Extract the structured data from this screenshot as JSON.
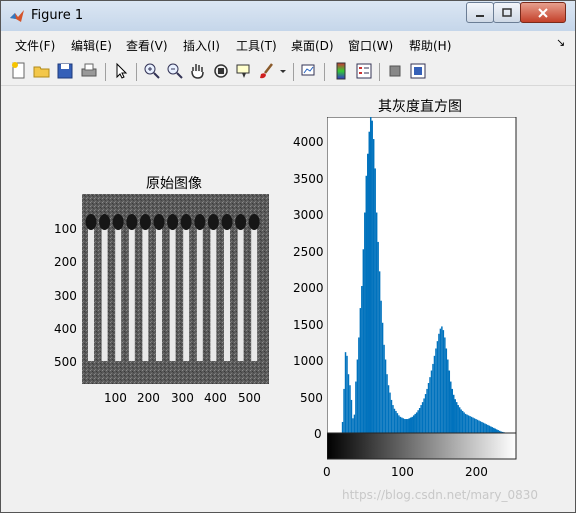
{
  "window": {
    "title": "Figure 1"
  },
  "menu": [
    "文件(F)",
    "编辑(E)",
    "查看(V)",
    "插入(I)",
    "工具(T)",
    "桌面(D)",
    "窗口(W)",
    "帮助(H)"
  ],
  "toolbar": {
    "icons": [
      "new-figure-icon",
      "open-file-icon",
      "save-icon",
      "print-icon",
      "pointer-icon",
      "zoom-in-icon",
      "zoom-out-icon",
      "pan-icon",
      "rotate-3d-icon",
      "data-cursor-icon",
      "brush-icon",
      "brush-dropdown-icon",
      "link-plot-icon",
      "colorbar-icon",
      "legend-icon",
      "hide-plot-tools-icon",
      "show-plot-tools-icon"
    ]
  },
  "left_axes": {
    "title": "原始图像",
    "y_ticks": [
      "100",
      "200",
      "300",
      "400",
      "500"
    ],
    "x_ticks": [
      "100",
      "200",
      "300",
      "400",
      "500"
    ]
  },
  "right_axes": {
    "title": "其灰度直方图",
    "y_ticks": [
      "4000",
      "3500",
      "3000",
      "2500",
      "2000",
      "1500",
      "1000",
      "500",
      "0"
    ],
    "x_ticks": [
      "0",
      "100",
      "200"
    ]
  },
  "watermark": "https://blog.csdn.net/mary_0830",
  "chart_data": {
    "type": "bar",
    "title": "其灰度直方图",
    "xlim": [
      0,
      255
    ],
    "ylim": [
      0,
      4300
    ],
    "x": [
      20,
      22,
      24,
      26,
      28,
      30,
      32,
      34,
      36,
      38,
      40,
      42,
      44,
      46,
      48,
      50,
      52,
      54,
      56,
      58,
      60,
      62,
      64,
      66,
      68,
      70,
      72,
      74,
      76,
      78,
      80,
      82,
      84,
      86,
      88,
      90,
      92,
      94,
      96,
      98,
      100,
      102,
      104,
      106,
      108,
      110,
      112,
      114,
      116,
      118,
      120,
      122,
      124,
      126,
      128,
      130,
      132,
      134,
      136,
      138,
      140,
      142,
      144,
      146,
      148,
      150,
      152,
      154,
      156,
      158,
      160,
      162,
      164,
      166,
      168,
      170,
      172,
      174,
      176,
      178,
      180,
      182,
      184,
      186,
      188,
      190,
      192,
      194,
      196,
      198,
      200,
      202,
      204,
      206,
      208,
      210,
      212,
      214,
      216,
      218,
      220,
      222,
      224,
      226,
      228,
      230,
      232,
      234,
      236,
      238,
      240,
      242,
      244,
      246,
      248,
      250,
      252,
      254
    ],
    "values": [
      150,
      600,
      1100,
      1050,
      800,
      650,
      450,
      200,
      250,
      700,
      1000,
      1300,
      1700,
      2000,
      2500,
      3000,
      3500,
      3800,
      4100,
      4300,
      4250,
      4000,
      3600,
      3000,
      2600,
      2200,
      1800,
      1500,
      1200,
      1000,
      800,
      650,
      550,
      450,
      380,
      330,
      300,
      270,
      240,
      220,
      210,
      200,
      190,
      190,
      190,
      200,
      210,
      220,
      240,
      260,
      280,
      310,
      340,
      380,
      420,
      470,
      530,
      600,
      680,
      760,
      850,
      940,
      1050,
      1150,
      1250,
      1350,
      1420,
      1450,
      1400,
      1300,
      1150,
      1000,
      850,
      700,
      600,
      520,
      460,
      420,
      380,
      350,
      320,
      300,
      280,
      260,
      250,
      240,
      230,
      220,
      210,
      200,
      190,
      180,
      170,
      160,
      150,
      140,
      130,
      120,
      110,
      100,
      90,
      80,
      70,
      60,
      50,
      40,
      30,
      20,
      15,
      10,
      5,
      3,
      2,
      1,
      0,
      0,
      0,
      0
    ]
  }
}
